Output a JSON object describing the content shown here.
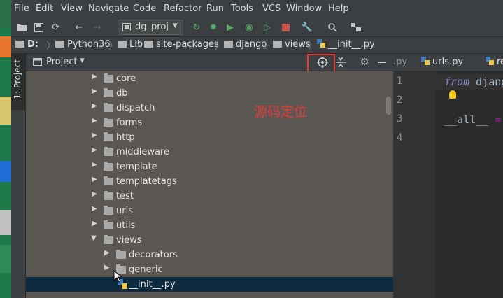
{
  "menubar": {
    "items": [
      "File",
      "Edit",
      "View",
      "Navigate",
      "Code",
      "Refactor",
      "Run",
      "Tools",
      "VCS",
      "Window",
      "Help"
    ]
  },
  "toolbar": {
    "run_config": "dg_proj"
  },
  "breadcrumb": {
    "items": [
      "D:",
      "Python36",
      "Lib",
      "site-packages",
      "django",
      "views",
      "__init__.py"
    ]
  },
  "tool_stripe": {
    "project_tab": "1: Project"
  },
  "project_panel": {
    "title": "Project",
    "annotation": "源码定位",
    "tree": [
      {
        "name": "core",
        "depth": 1,
        "expanded": false,
        "type": "folder"
      },
      {
        "name": "db",
        "depth": 1,
        "expanded": false,
        "type": "folder"
      },
      {
        "name": "dispatch",
        "depth": 1,
        "expanded": false,
        "type": "folder"
      },
      {
        "name": "forms",
        "depth": 1,
        "expanded": false,
        "type": "folder"
      },
      {
        "name": "http",
        "depth": 1,
        "expanded": false,
        "type": "folder"
      },
      {
        "name": "middleware",
        "depth": 1,
        "expanded": false,
        "type": "folder"
      },
      {
        "name": "template",
        "depth": 1,
        "expanded": false,
        "type": "folder"
      },
      {
        "name": "templatetags",
        "depth": 1,
        "expanded": false,
        "type": "folder"
      },
      {
        "name": "test",
        "depth": 1,
        "expanded": false,
        "type": "folder"
      },
      {
        "name": "urls",
        "depth": 1,
        "expanded": false,
        "type": "folder"
      },
      {
        "name": "utils",
        "depth": 1,
        "expanded": false,
        "type": "folder"
      },
      {
        "name": "views",
        "depth": 1,
        "expanded": true,
        "type": "folder"
      },
      {
        "name": "decorators",
        "depth": 2,
        "expanded": false,
        "type": "folder"
      },
      {
        "name": "generic",
        "depth": 2,
        "expanded": false,
        "type": "folder"
      },
      {
        "name": "__init__.py",
        "depth": 2,
        "type": "file",
        "selected": true
      }
    ]
  },
  "editor": {
    "tabs": [
      ".py",
      "urls.py",
      "re"
    ],
    "line_numbers": [
      "1",
      "2",
      "3",
      "4"
    ],
    "code": {
      "line1_kw": "from",
      "line1_rest": " djang",
      "line3": "__all__",
      "line3_rest": " ="
    }
  },
  "colors": {
    "accent_highlight": "#e53935",
    "annotation": "#e03c3c",
    "selection": "#0d293e"
  }
}
